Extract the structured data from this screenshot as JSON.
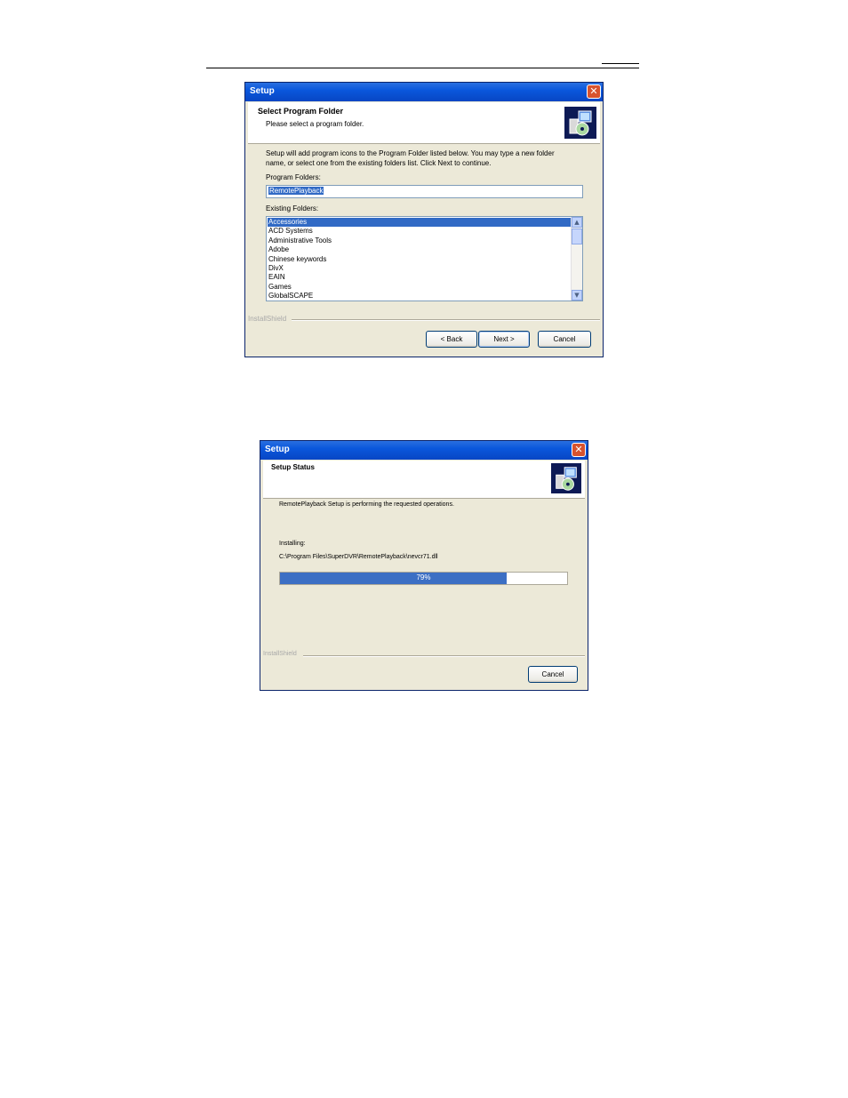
{
  "dialog1": {
    "title": "Setup",
    "header_title": "Select Program Folder",
    "header_subtitle": "Please select a program folder.",
    "description_line1": "Setup will add program icons to the Program Folder listed below.  You may type a new folder",
    "description_line2": "name, or select one from the existing folders list.  Click Next to continue.",
    "program_folders_label": "Program Folders:",
    "program_folder_value": "RemotePlayback",
    "existing_folders_label": "Existing Folders:",
    "existing_folders": [
      "Accessories",
      "ACD Systems",
      "Administrative Tools",
      "Adobe",
      "Chinese keywords",
      "DivX",
      "EAIN",
      "Games",
      "GlobalSCAPE"
    ],
    "selected_index": 0,
    "brand": "InstallShield",
    "back_label": "< Back",
    "next_label": "Next >",
    "cancel_label": "Cancel"
  },
  "dialog2": {
    "title": "Setup",
    "header_title": "Setup Status",
    "status_text": "RemotePlayback Setup is performing the requested operations.",
    "installing_label": "Installing:",
    "installing_path": "C:\\Program Files\\SuperDVR\\RemotePlayback\\nevcr71.dll",
    "progress_percent": 79,
    "progress_label": "79%",
    "brand": "InstallShield",
    "cancel_label": "Cancel"
  },
  "colors": {
    "titlebar": "#0a57dc",
    "selection": "#316ac5",
    "progress": "#3c6fc4",
    "close": "#d7532e"
  },
  "icons": [
    "close-icon",
    "setup-icon",
    "scroll-up-icon",
    "scroll-down-icon"
  ]
}
